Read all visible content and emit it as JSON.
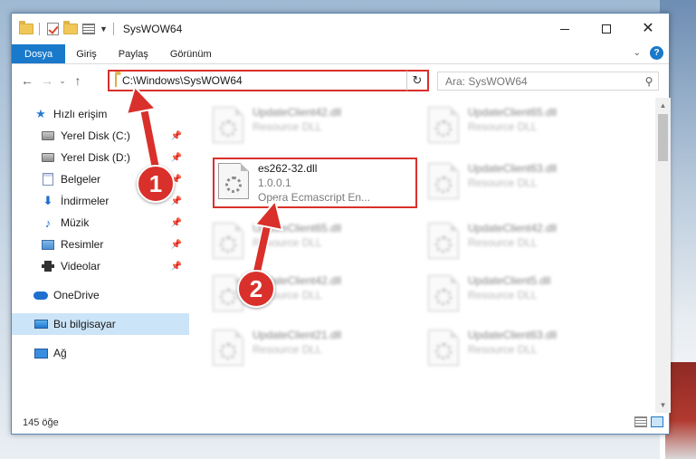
{
  "window": {
    "title": "SysWOW64"
  },
  "ribbon": {
    "tabs": [
      {
        "label": "Dosya"
      },
      {
        "label": "Giriş"
      },
      {
        "label": "Paylaş"
      },
      {
        "label": "Görünüm"
      }
    ],
    "help": "?"
  },
  "address": {
    "path": "C:\\Windows\\SysWOW64",
    "search_placeholder": "Ara: SysWOW64"
  },
  "nav": {
    "quick_access": "Hızlı erişim",
    "items": [
      {
        "label": "Yerel Disk (C:)"
      },
      {
        "label": "Yerel Disk (D:)"
      },
      {
        "label": "Belgeler"
      },
      {
        "label": "İndirmeler"
      },
      {
        "label": "Müzik"
      },
      {
        "label": "Resimler"
      },
      {
        "label": "Videolar"
      }
    ],
    "onedrive": "OneDrive",
    "this_pc": "Bu bilgisayar",
    "network": "Ağ"
  },
  "files": {
    "focused": {
      "name": "es262-32.dll",
      "version": "1.0.0.1",
      "description": "Opera Ecmascript En..."
    },
    "blurred": [
      {
        "name": "UpdateClient42.dll",
        "sub": "Resource DLL"
      },
      {
        "name": "UpdateClient65.dll",
        "sub": "Resource DLL"
      },
      {
        "name": "UpdateClient63.dll",
        "sub": "Resource DLL"
      },
      {
        "name": "UpdateClient65.dll",
        "sub": "Resource DLL"
      },
      {
        "name": "UpdateClient42.dll",
        "sub": "Resource DLL"
      },
      {
        "name": "UpdateClient42.dll",
        "sub": "Resource DLL"
      },
      {
        "name": "UpdateClient5.dll",
        "sub": "Resource DLL"
      },
      {
        "name": "UpdateClient21.dll",
        "sub": "Resource DLL"
      },
      {
        "name": "UpdateClient63.dll",
        "sub": "Resource DLL"
      }
    ]
  },
  "status": {
    "count": "145 öğe"
  },
  "annotations": {
    "step1": "1",
    "step2": "2",
    "accent": "#d9302b"
  }
}
